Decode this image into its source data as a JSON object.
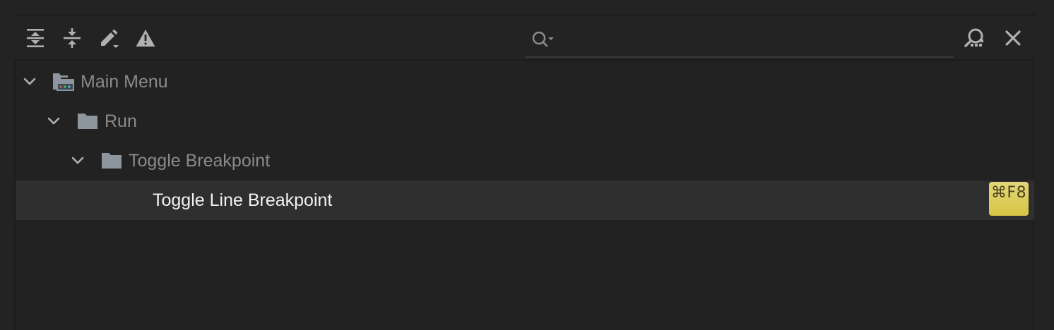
{
  "toolbar": {
    "expand_all_icon": "expand-all-icon",
    "collapse_all_icon": "collapse-all-icon",
    "edit_icon": "pencil-dropdown-icon",
    "conflicts_icon": "warning-triangle-icon",
    "find_by_shortcut_icon": "find-shortcut-icon",
    "close_icon": "close-icon"
  },
  "search": {
    "value": "",
    "placeholder": "",
    "icon": "search-dropdown-icon"
  },
  "tree": {
    "items": [
      {
        "label": "Main Menu",
        "icon": "main-menu-icon",
        "expanded": true,
        "level": 0
      },
      {
        "label": "Run",
        "icon": "folder-icon",
        "expanded": true,
        "level": 1
      },
      {
        "label": "Toggle Breakpoint",
        "icon": "folder-icon",
        "expanded": true,
        "level": 2
      },
      {
        "label": "Toggle Line Breakpoint",
        "level": 3,
        "selected": true,
        "shortcut": "⌘F8"
      }
    ]
  },
  "colors": {
    "background": "#232323",
    "selected_row": "#2f2f2f",
    "shortcut_badge": "#dccb55",
    "muted_text": "#8a8a8a",
    "icon": "#a8a8a8"
  }
}
